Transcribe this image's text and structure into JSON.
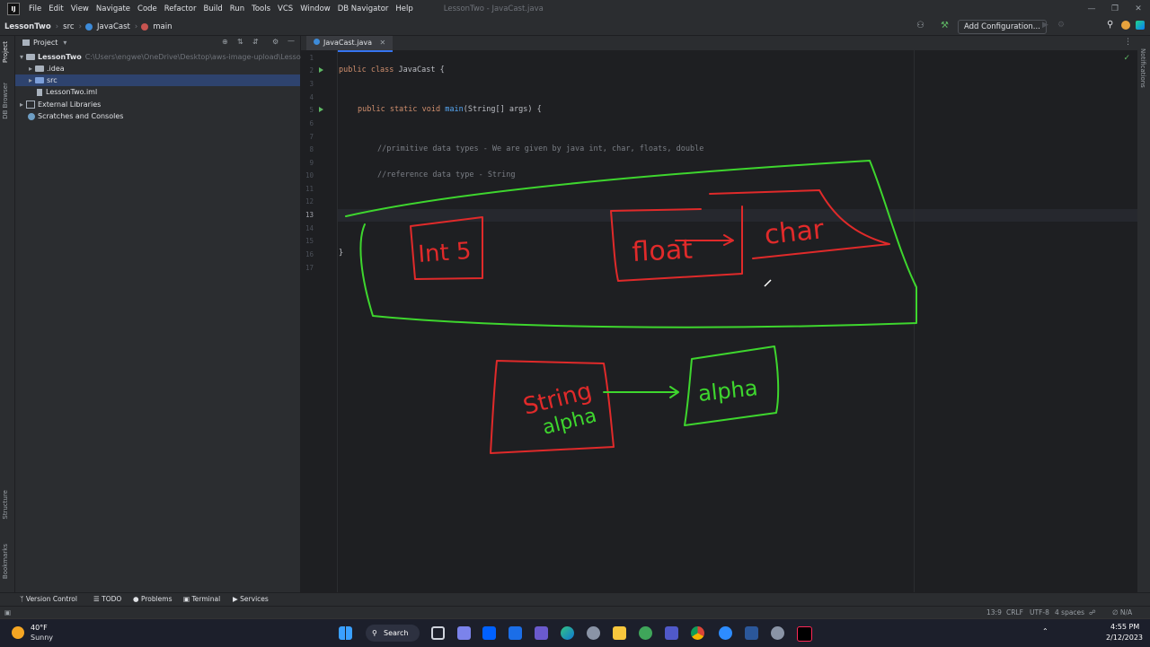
{
  "titlebar": {
    "menu": [
      "File",
      "Edit",
      "View",
      "Navigate",
      "Code",
      "Refactor",
      "Build",
      "Run",
      "Tools",
      "VCS",
      "Window",
      "DB Navigator",
      "Help"
    ],
    "window_title": "LessonTwo - JavaCast.java"
  },
  "navbar": {
    "crumbs": [
      "LessonTwo",
      "src",
      "JavaCast",
      "main"
    ],
    "add_configuration": "Add Configuration..."
  },
  "left_strip": {
    "project": "Project",
    "db_browser": "DB Browser",
    "structure": "Structure",
    "bookmarks": "Bookmarks"
  },
  "right_strip": {
    "notifications": "Notifications"
  },
  "project": {
    "header": "Project",
    "tree": [
      {
        "label": "LessonTwo",
        "path": "C:\\Users\\engwe\\OneDrive\\Desktop\\aws-image-upload\\LessonTwo"
      },
      {
        "label": ".idea"
      },
      {
        "label": "src"
      },
      {
        "label": "LessonTwo.iml"
      },
      {
        "label": "External Libraries"
      },
      {
        "label": "Scratches and Consoles"
      }
    ]
  },
  "editor": {
    "tab": "JavaCast.java",
    "line_numbers": [
      "1",
      "2",
      "3",
      "4",
      "5",
      "6",
      "7",
      "8",
      "9",
      "10",
      "11",
      "12",
      "13",
      "14",
      "15",
      "16",
      "17"
    ],
    "code": {
      "l2_kw": "public class ",
      "l2_name": "JavaCast {",
      "l5_kw": "public static void ",
      "l5_fn": "main",
      "l5_rest": "(String[] args) {",
      "l8": "//primitive data types - We are given by java int, char, floats, double",
      "l10": "//reference data type - String",
      "l16": "}"
    }
  },
  "annotations": {
    "int": "Int 5",
    "float": "float",
    "char": "char",
    "string": "String",
    "string2": "alpha",
    "alpha": "alpha"
  },
  "bottombar": [
    "Version Control",
    "TODO",
    "Problems",
    "Terminal",
    "Services"
  ],
  "statusbar": {
    "pos": "13:9",
    "crlf": "CRLF",
    "enc": "UTF-8",
    "indent": "4 spaces",
    "misc": "∅ N/A"
  },
  "taskbar": {
    "weather_temp": "40°F",
    "weather_desc": "Sunny",
    "search": "Search",
    "time": "4:55 PM",
    "date": "2/12/2023"
  },
  "colors": {
    "accent": "#3574f0",
    "ink_green": "#3ed62e",
    "ink_red": "#e02a2a"
  }
}
